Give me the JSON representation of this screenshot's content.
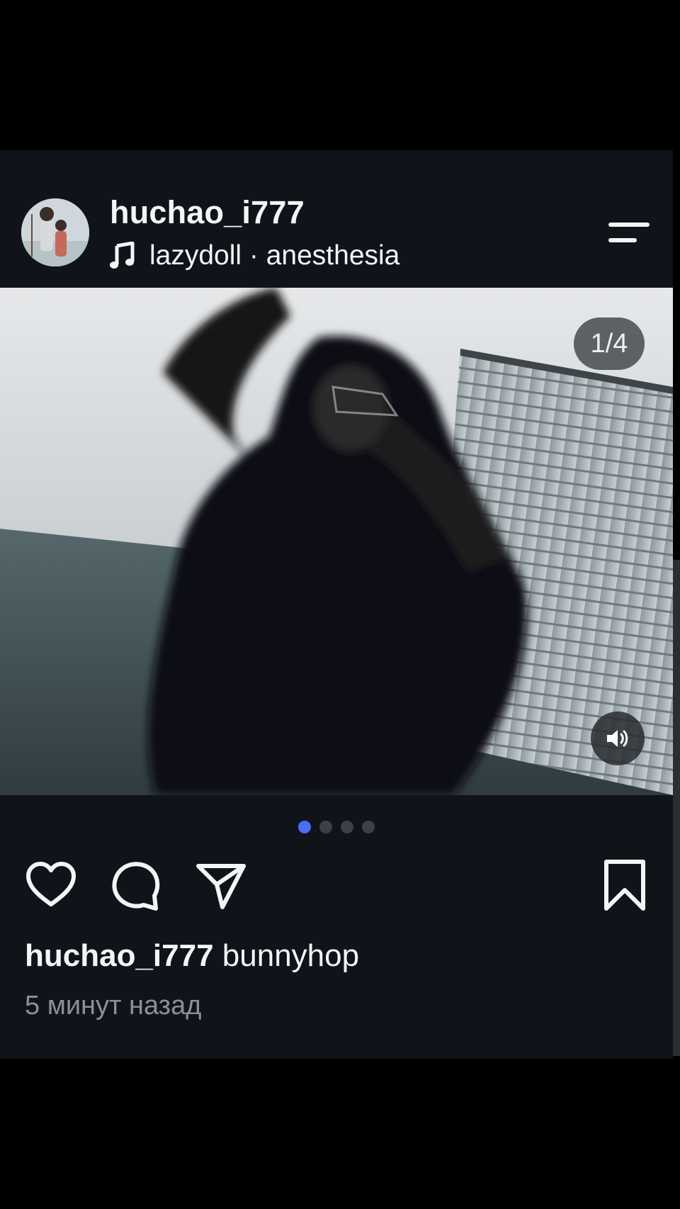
{
  "post": {
    "username": "huchao_i777",
    "music_label": "lazydoll · anesthesia",
    "media_counter": "1/4",
    "carousel_total": 4,
    "carousel_active_index": 0,
    "caption_user": "huchao_i777",
    "caption_text": "bunnyhop",
    "timestamp": "5 минут назад"
  },
  "icons": {
    "music": "music-note-icon",
    "menu": "menu-icon",
    "sound": "volume-icon",
    "like": "heart-icon",
    "comment": "comment-icon",
    "share": "send-icon",
    "save": "bookmark-icon"
  },
  "colors": {
    "background": "#000000",
    "card": "#10141a",
    "text": "#f4f5f7",
    "muted_text": "#8b9098",
    "dot_active": "#4c6ef5",
    "dot_inactive": "#3b4049"
  }
}
